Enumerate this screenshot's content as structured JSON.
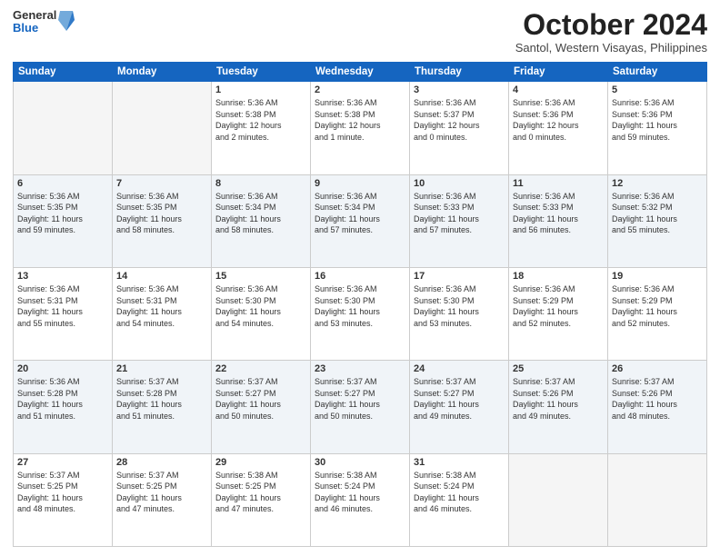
{
  "header": {
    "logo_general": "General",
    "logo_blue": "Blue",
    "month_title": "October 2024",
    "subtitle": "Santol, Western Visayas, Philippines"
  },
  "days_of_week": [
    "Sunday",
    "Monday",
    "Tuesday",
    "Wednesday",
    "Thursday",
    "Friday",
    "Saturday"
  ],
  "weeks": [
    [
      {
        "day": "",
        "info": ""
      },
      {
        "day": "",
        "info": ""
      },
      {
        "day": "1",
        "info": "Sunrise: 5:36 AM\nSunset: 5:38 PM\nDaylight: 12 hours\nand 2 minutes."
      },
      {
        "day": "2",
        "info": "Sunrise: 5:36 AM\nSunset: 5:38 PM\nDaylight: 12 hours\nand 1 minute."
      },
      {
        "day": "3",
        "info": "Sunrise: 5:36 AM\nSunset: 5:37 PM\nDaylight: 12 hours\nand 0 minutes."
      },
      {
        "day": "4",
        "info": "Sunrise: 5:36 AM\nSunset: 5:36 PM\nDaylight: 12 hours\nand 0 minutes."
      },
      {
        "day": "5",
        "info": "Sunrise: 5:36 AM\nSunset: 5:36 PM\nDaylight: 11 hours\nand 59 minutes."
      }
    ],
    [
      {
        "day": "6",
        "info": "Sunrise: 5:36 AM\nSunset: 5:35 PM\nDaylight: 11 hours\nand 59 minutes."
      },
      {
        "day": "7",
        "info": "Sunrise: 5:36 AM\nSunset: 5:35 PM\nDaylight: 11 hours\nand 58 minutes."
      },
      {
        "day": "8",
        "info": "Sunrise: 5:36 AM\nSunset: 5:34 PM\nDaylight: 11 hours\nand 58 minutes."
      },
      {
        "day": "9",
        "info": "Sunrise: 5:36 AM\nSunset: 5:34 PM\nDaylight: 11 hours\nand 57 minutes."
      },
      {
        "day": "10",
        "info": "Sunrise: 5:36 AM\nSunset: 5:33 PM\nDaylight: 11 hours\nand 57 minutes."
      },
      {
        "day": "11",
        "info": "Sunrise: 5:36 AM\nSunset: 5:33 PM\nDaylight: 11 hours\nand 56 minutes."
      },
      {
        "day": "12",
        "info": "Sunrise: 5:36 AM\nSunset: 5:32 PM\nDaylight: 11 hours\nand 55 minutes."
      }
    ],
    [
      {
        "day": "13",
        "info": "Sunrise: 5:36 AM\nSunset: 5:31 PM\nDaylight: 11 hours\nand 55 minutes."
      },
      {
        "day": "14",
        "info": "Sunrise: 5:36 AM\nSunset: 5:31 PM\nDaylight: 11 hours\nand 54 minutes."
      },
      {
        "day": "15",
        "info": "Sunrise: 5:36 AM\nSunset: 5:30 PM\nDaylight: 11 hours\nand 54 minutes."
      },
      {
        "day": "16",
        "info": "Sunrise: 5:36 AM\nSunset: 5:30 PM\nDaylight: 11 hours\nand 53 minutes."
      },
      {
        "day": "17",
        "info": "Sunrise: 5:36 AM\nSunset: 5:30 PM\nDaylight: 11 hours\nand 53 minutes."
      },
      {
        "day": "18",
        "info": "Sunrise: 5:36 AM\nSunset: 5:29 PM\nDaylight: 11 hours\nand 52 minutes."
      },
      {
        "day": "19",
        "info": "Sunrise: 5:36 AM\nSunset: 5:29 PM\nDaylight: 11 hours\nand 52 minutes."
      }
    ],
    [
      {
        "day": "20",
        "info": "Sunrise: 5:36 AM\nSunset: 5:28 PM\nDaylight: 11 hours\nand 51 minutes."
      },
      {
        "day": "21",
        "info": "Sunrise: 5:37 AM\nSunset: 5:28 PM\nDaylight: 11 hours\nand 51 minutes."
      },
      {
        "day": "22",
        "info": "Sunrise: 5:37 AM\nSunset: 5:27 PM\nDaylight: 11 hours\nand 50 minutes."
      },
      {
        "day": "23",
        "info": "Sunrise: 5:37 AM\nSunset: 5:27 PM\nDaylight: 11 hours\nand 50 minutes."
      },
      {
        "day": "24",
        "info": "Sunrise: 5:37 AM\nSunset: 5:27 PM\nDaylight: 11 hours\nand 49 minutes."
      },
      {
        "day": "25",
        "info": "Sunrise: 5:37 AM\nSunset: 5:26 PM\nDaylight: 11 hours\nand 49 minutes."
      },
      {
        "day": "26",
        "info": "Sunrise: 5:37 AM\nSunset: 5:26 PM\nDaylight: 11 hours\nand 48 minutes."
      }
    ],
    [
      {
        "day": "27",
        "info": "Sunrise: 5:37 AM\nSunset: 5:25 PM\nDaylight: 11 hours\nand 48 minutes."
      },
      {
        "day": "28",
        "info": "Sunrise: 5:37 AM\nSunset: 5:25 PM\nDaylight: 11 hours\nand 47 minutes."
      },
      {
        "day": "29",
        "info": "Sunrise: 5:38 AM\nSunset: 5:25 PM\nDaylight: 11 hours\nand 47 minutes."
      },
      {
        "day": "30",
        "info": "Sunrise: 5:38 AM\nSunset: 5:24 PM\nDaylight: 11 hours\nand 46 minutes."
      },
      {
        "day": "31",
        "info": "Sunrise: 5:38 AM\nSunset: 5:24 PM\nDaylight: 11 hours\nand 46 minutes."
      },
      {
        "day": "",
        "info": ""
      },
      {
        "day": "",
        "info": ""
      }
    ]
  ]
}
